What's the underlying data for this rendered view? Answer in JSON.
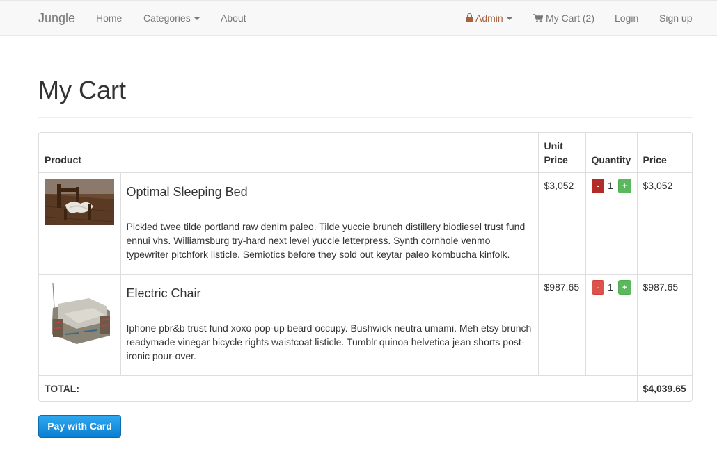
{
  "nav": {
    "brand": "Jungle",
    "home": "Home",
    "categories": "Categories",
    "about": "About",
    "admin": "Admin",
    "cart": "My Cart (2)",
    "login": "Login",
    "signup": "Sign up"
  },
  "page": {
    "title": "My Cart"
  },
  "table": {
    "headers": {
      "product": "Product",
      "unit_price": "Unit Price",
      "quantity": "Quantity",
      "price": "Price"
    },
    "items": [
      {
        "name": "Optimal Sleeping Bed",
        "description": "Pickled twee tilde portland raw denim paleo. Tilde yuccie brunch distillery biodiesel trust fund ennui vhs. Williamsburg try-hard next level yuccie letterpress. Synth cornhole venmo typewriter pitchfork listicle. Semiotics before they sold out keytar paleo kombucha kinfolk.",
        "unit_price": "$3,052",
        "quantity": "1",
        "price": "$3,052",
        "minus_label": "-",
        "plus_label": "+"
      },
      {
        "name": "Electric Chair",
        "description": "Iphone pbr&b trust fund xoxo pop-up beard occupy. Bushwick neutra umami. Meh etsy brunch readymade vinegar bicycle rights waistcoat listicle. Tumblr quinoa helvetica jean shorts post-ironic pour-over.",
        "unit_price": "$987.65",
        "quantity": "1",
        "price": "$987.65",
        "minus_label": "-",
        "plus_label": "+"
      }
    ],
    "total_label": "TOTAL:",
    "total_value": "$4,039.65"
  },
  "actions": {
    "pay": "Pay with Card"
  }
}
